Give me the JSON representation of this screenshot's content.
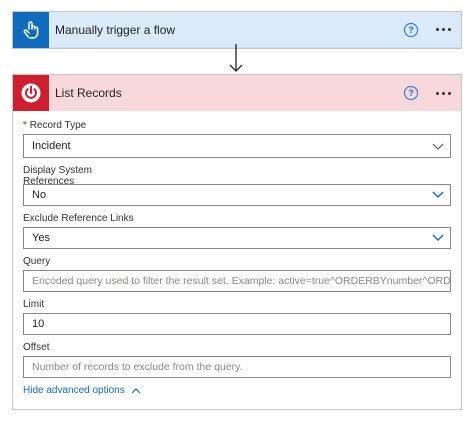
{
  "trigger": {
    "title": "Manually trigger a flow",
    "help_glyph": "?"
  },
  "action": {
    "title": "List Records",
    "help_glyph": "?",
    "fields": {
      "record_type": {
        "required_mark": "*",
        "label": "Record Type",
        "value": "Incident"
      },
      "display_system_references": {
        "label": "Display System References",
        "value": "No"
      },
      "exclude_reference_links": {
        "label": "Exclude Reference Links",
        "value": "Yes"
      },
      "query": {
        "label": "Query",
        "placeholder": "Encoded query used to filter the result set. Example: active=true^ORDERBYnumber^ORD"
      },
      "limit": {
        "label": "Limit",
        "value": "10"
      },
      "offset": {
        "label": "Offset",
        "placeholder": "Number of records to exclude from the query."
      }
    },
    "advanced_link": "Hide advanced options"
  },
  "colors": {
    "trigger_header_bg": "#daeaf9",
    "trigger_icon_bg": "#0f6cbd",
    "action_header_bg": "#f7d9db",
    "action_icon_bg": "#cf1f2e",
    "link": "#0f6cbd"
  },
  "icons": {
    "trigger": "hand-tap-icon",
    "action": "power-icon",
    "help": "help-circle-icon",
    "more": "more-dots-icon",
    "dropdown": "chevron-down-icon"
  }
}
